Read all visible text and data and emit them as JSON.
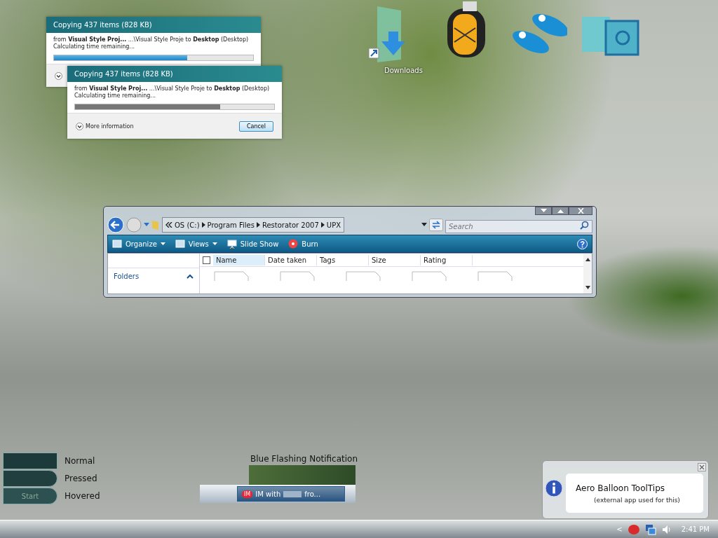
{
  "desktop_icons": [
    {
      "kind": "download-folder",
      "label": "Downloads"
    },
    {
      "kind": "backpack"
    },
    {
      "kind": "sandals"
    },
    {
      "kind": "recycle-bin"
    }
  ],
  "copy_dialogs": [
    {
      "title": "Copying 437 items (828 KB)",
      "detail": "from **Visual Style Proj...** ...\\Visual Style Proje to **Desktop** (Desktop)",
      "status": "Calculating time remaining...",
      "level": 0.67,
      "active": true
    },
    {
      "title": "Copying 437 items (828 KB)",
      "detail": "from **Visual Style Proj...** ...\\Visual Style Proje to **Desktop** (Desktop)",
      "status": "Calculating time remaining...",
      "level": 0.73,
      "active": false,
      "more_information": "More information",
      "cancel_button": "Cancel"
    }
  ],
  "explorer": {
    "breadcrumbs": [
      "OS (C:)",
      "Program Files",
      "Restorator 2007",
      "UPX"
    ],
    "search": {
      "placeholder": "Search"
    },
    "toolbar": [
      {
        "label": "Organize",
        "kind": "menu"
      },
      {
        "label": "Views",
        "kind": "menu"
      },
      {
        "label": "Slide Show",
        "kind": "slideshow"
      },
      {
        "label": "Burn",
        "kind": "burn"
      }
    ],
    "columns": [
      {
        "label": "Name",
        "selected": true
      },
      {
        "label": "Date taken",
        "selected": false
      },
      {
        "label": "Tags",
        "selected": false
      },
      {
        "label": "Size",
        "selected": false
      },
      {
        "label": "Rating",
        "selected": false
      }
    ],
    "folders_label": "Folders"
  },
  "start_button_states": [
    {
      "label": "Normal",
      "kind": "normal"
    },
    {
      "label": "Pressed",
      "kind": "pressed"
    },
    {
      "label": "Hovered",
      "kind": "hovered",
      "button_text": "Start"
    }
  ],
  "notification_demo": {
    "title": "Blue Flashing Notification",
    "badge": "IM",
    "text_start": "IM with",
    "text_end": "fro..."
  },
  "balloon": {
    "title": "Aero Balloon ToolTips",
    "body": "(external app used for this)"
  },
  "taskbar": {
    "clock": "2:41 PM",
    "tray_chevron": "<"
  }
}
